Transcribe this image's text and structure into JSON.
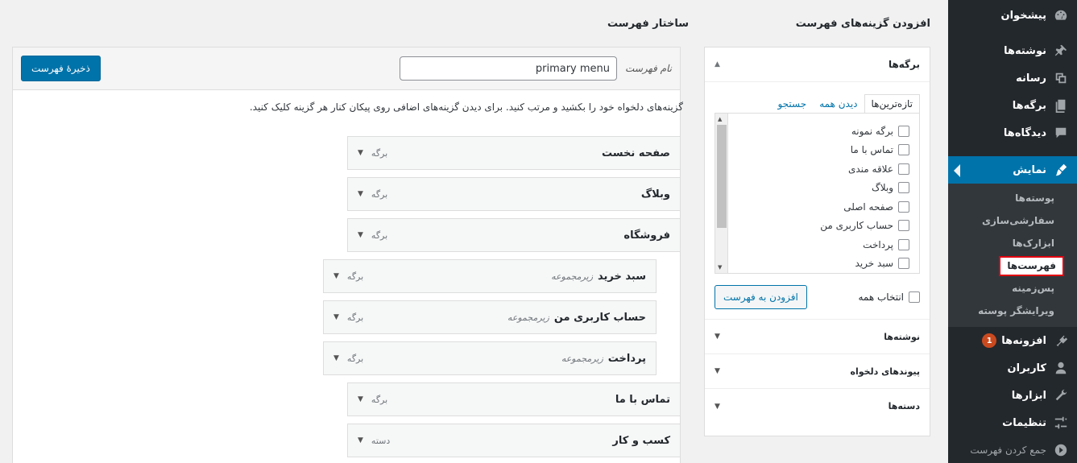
{
  "sidebar": {
    "items": [
      {
        "label": "پیشخوان",
        "icon": "dashboard-icon"
      },
      {
        "label": "نوشته‌ها",
        "icon": "pin-icon"
      },
      {
        "label": "رسانه",
        "icon": "media-icon"
      },
      {
        "label": "برگه‌ها",
        "icon": "page-icon"
      },
      {
        "label": "دیدگاه‌ها",
        "icon": "comment-icon"
      },
      {
        "label": "نمایش",
        "icon": "brush-icon"
      }
    ],
    "appearance_sub": [
      "پوسته‌ها",
      "سفارشی‌سازی",
      "ابزارک‌ها",
      "فهرست‌ها",
      "پس‌زمینه",
      "ویرایشگر پوسته"
    ],
    "bottom": [
      {
        "label": "افزونه‌ها",
        "icon": "plugin-icon",
        "badge": "1"
      },
      {
        "label": "کاربران",
        "icon": "users-icon"
      },
      {
        "label": "ابزارها",
        "icon": "tools-icon"
      },
      {
        "label": "تنظیمات",
        "icon": "settings-icon"
      }
    ],
    "collapse": "جمع کردن فهرست"
  },
  "headings": {
    "add_items": "افزودن گزینه‌های فهرست",
    "structure": "ساختار فهرست"
  },
  "add_panel": {
    "pages_title": "برگه‌ها",
    "tabs": [
      "تازه‌ترین‌ها",
      "دیدن همه",
      "جستجو"
    ],
    "pages": [
      "برگه نمونه",
      "تماس با ما",
      "علاقه مندی",
      "وبلاگ",
      "صفحه اصلی",
      "حساب کاربری من",
      "پرداخت",
      "سبد خرید"
    ],
    "select_all": "انتخاب همه",
    "add_button": "افزودن به فهرست",
    "sections": [
      "نوشته‌ها",
      "پیوندهای دلخواه",
      "دسته‌ها"
    ]
  },
  "structure": {
    "menu_name_label": "نام فهرست",
    "menu_name_value": "primary menu",
    "save_button": "ذخیرهٔ فهرست",
    "instructions": "گزینه‌های دلخواه خود را بکشید و مرتب کنید. برای دیدن گزینه‌های اضافی روی پیکان کنار هر گزینه کلیک کنید.",
    "items": [
      {
        "title": "صفحه نخست",
        "sub": "",
        "type": "برگه",
        "depth": 0
      },
      {
        "title": "وبلاگ",
        "sub": "",
        "type": "برگه",
        "depth": 0
      },
      {
        "title": "فروشگاه",
        "sub": "",
        "type": "برگه",
        "depth": 0
      },
      {
        "title": "سبد خرید",
        "sub": "زیرمجموعه",
        "type": "برگه",
        "depth": 1
      },
      {
        "title": "حساب کاربری من",
        "sub": "زیرمجموعه",
        "type": "برگه",
        "depth": 1
      },
      {
        "title": "پرداخت",
        "sub": "زیرمجموعه",
        "type": "برگه",
        "depth": 1
      },
      {
        "title": "تماس با ما",
        "sub": "",
        "type": "برگه",
        "depth": 0
      },
      {
        "title": "کسب و کار",
        "sub": "",
        "type": "دسته",
        "depth": 0
      }
    ]
  }
}
